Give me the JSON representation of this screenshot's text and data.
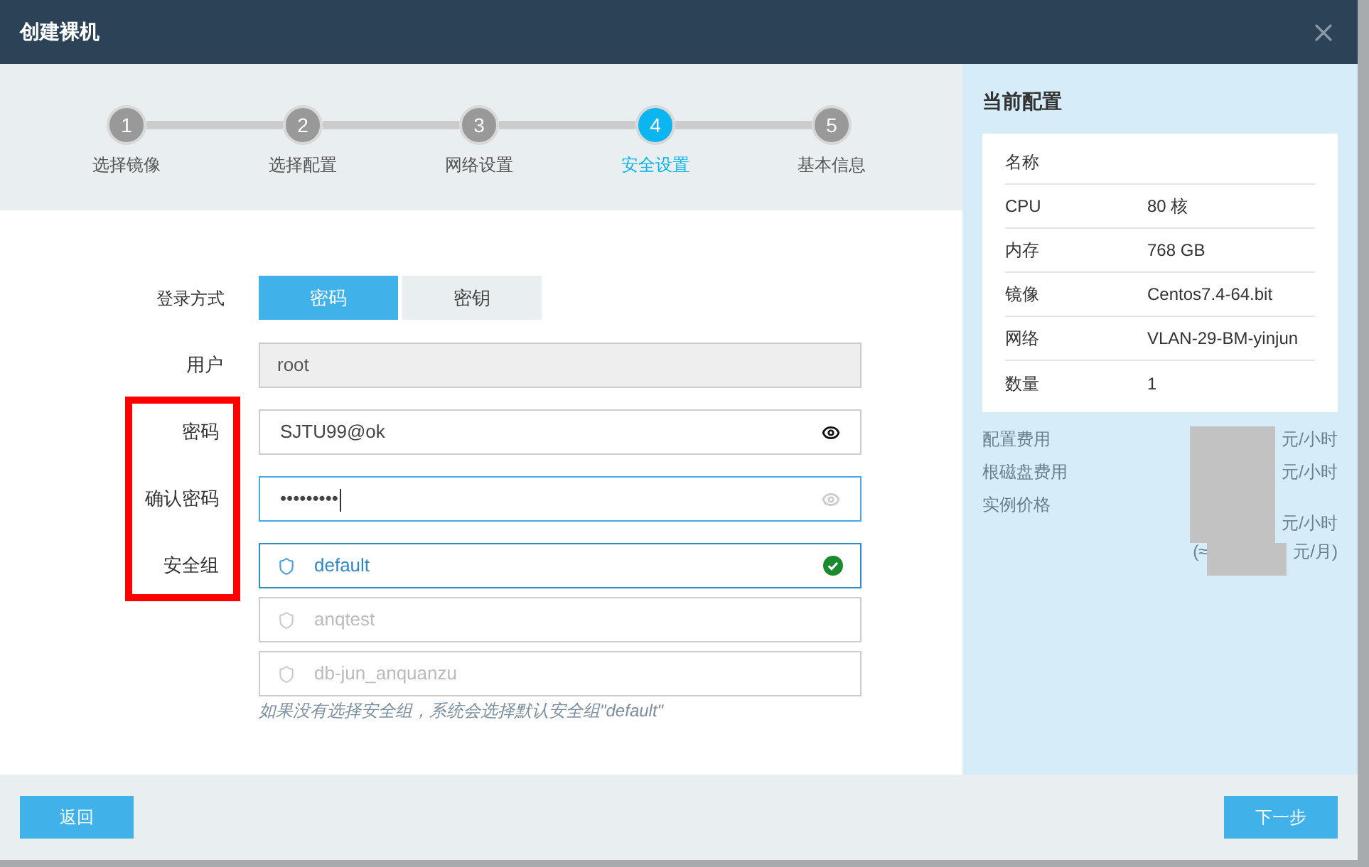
{
  "window": {
    "title": "创建裸机"
  },
  "steps": [
    {
      "number": "1",
      "label": "选择镜像",
      "selected": false
    },
    {
      "number": "2",
      "label": "选择配置",
      "selected": false
    },
    {
      "number": "3",
      "label": "网络设置",
      "selected": false
    },
    {
      "number": "4",
      "label": "安全设置",
      "selected": true
    },
    {
      "number": "5",
      "label": "基本信息",
      "selected": false
    }
  ],
  "login": {
    "label": "登录方式",
    "options": [
      {
        "label": "密码",
        "selected": true
      },
      {
        "label": "密钥",
        "selected": false
      }
    ]
  },
  "user": {
    "label": "用户",
    "value": "root",
    "disabled": true
  },
  "password": {
    "label": "密码",
    "value": "SJTU99@ok",
    "revealed": true,
    "focused": false
  },
  "confirm_password": {
    "label": "确认密码",
    "value": "•••••••••",
    "revealed": false,
    "focused": true
  },
  "security_group": {
    "label": "安全组",
    "options": [
      {
        "label": "default",
        "selected": true
      },
      {
        "label": "anqtest",
        "selected": false
      },
      {
        "label": "db-jun_anquanzu",
        "selected": false
      }
    ],
    "hint": "如果没有选择安全组，系统会选择默认安全组\"default\""
  },
  "current_config": {
    "title": "当前配置",
    "rows": [
      {
        "key": "名称",
        "value": ""
      },
      {
        "key": "CPU",
        "value": "80 核"
      },
      {
        "key": "内存",
        "value": "768 GB"
      },
      {
        "key": "镜像",
        "value": "Centos7.4-64.bit"
      },
      {
        "key": "网络",
        "value": "VLAN-29-BM-yinjun"
      },
      {
        "key": "数量",
        "value": "1"
      }
    ]
  },
  "costs": [
    {
      "label": "配置费用",
      "unit": "元/小时"
    },
    {
      "label": "根磁盘费用",
      "unit": "元/小时"
    },
    {
      "label": "实例价格",
      "unit": "元/小时"
    }
  ],
  "monthly": {
    "prefix": "(≈",
    "unit": "元/月)"
  },
  "buttons": {
    "back": "返回",
    "next": "下一步"
  }
}
